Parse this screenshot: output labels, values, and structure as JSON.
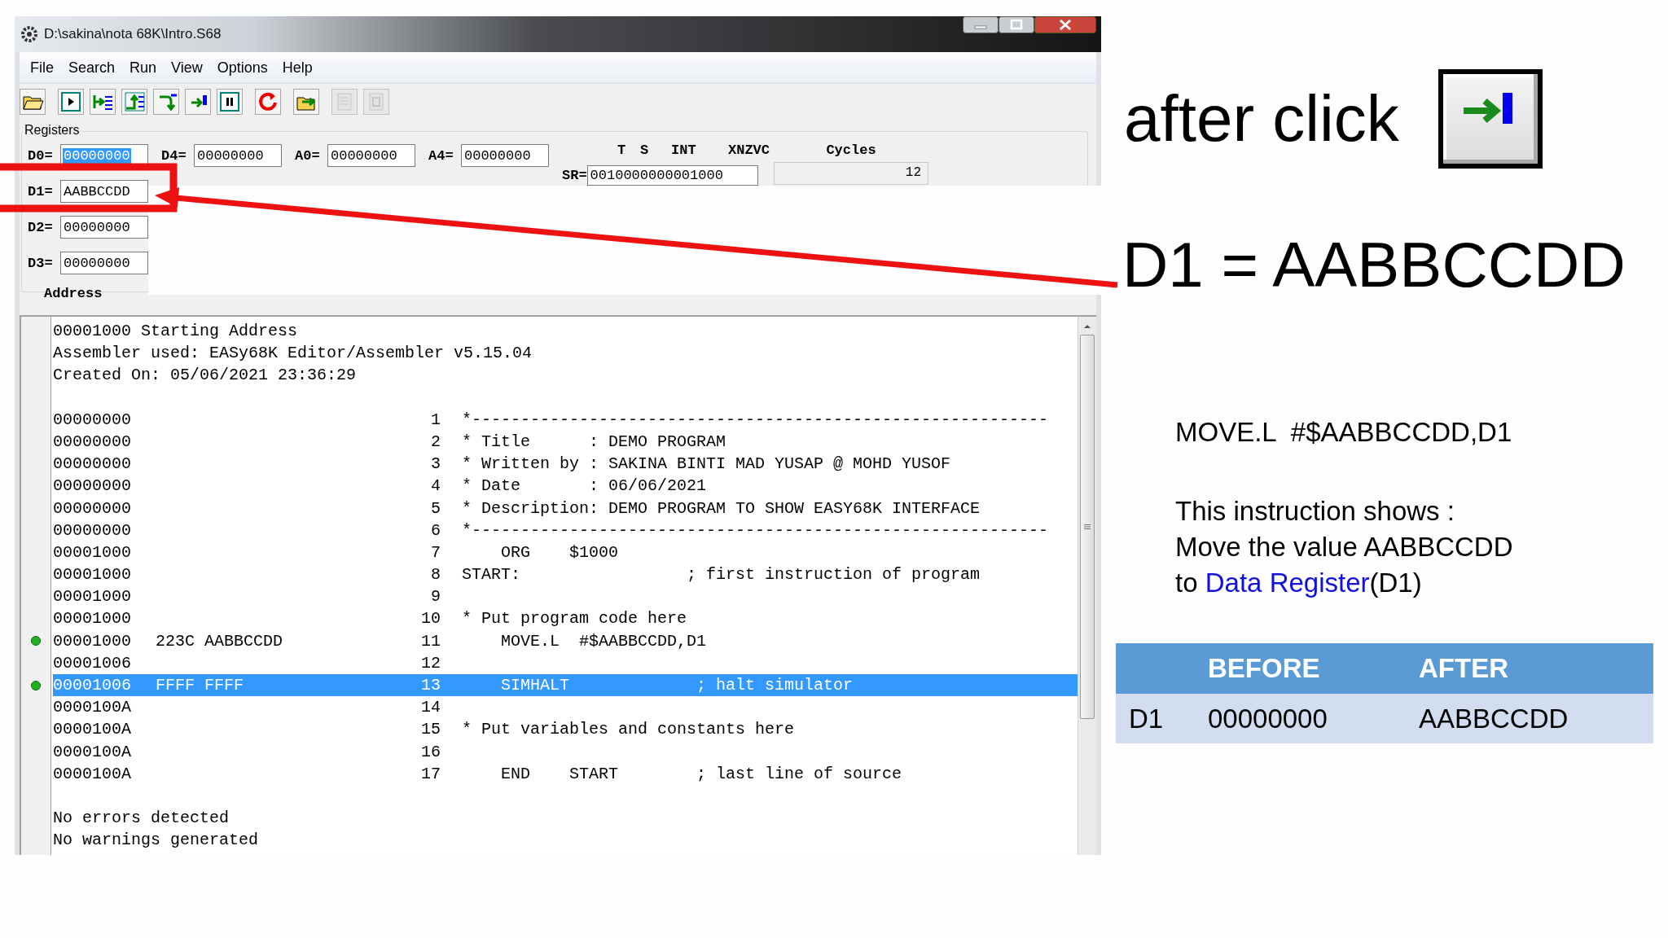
{
  "window": {
    "title": "D:\\sakina\\nota 68K\\Intro.S68"
  },
  "menu": [
    "File",
    "Search",
    "Run",
    "View",
    "Options",
    "Help"
  ],
  "toolbar": [
    {
      "kind": "open",
      "disabled": false
    },
    {
      "kind": "run",
      "disabled": false
    },
    {
      "kind": "run-to-cursor",
      "disabled": false
    },
    {
      "kind": "auto-trace",
      "disabled": false
    },
    {
      "kind": "step-over",
      "disabled": false
    },
    {
      "kind": "trace-into",
      "disabled": false
    },
    {
      "kind": "pause",
      "disabled": false
    },
    {
      "kind": "rewind",
      "disabled": false
    },
    {
      "kind": "reload",
      "disabled": false
    },
    {
      "kind": "log-start",
      "disabled": true
    },
    {
      "kind": "log-stop",
      "disabled": true
    }
  ],
  "registers": {
    "title": "Registers",
    "row": [
      {
        "label": "D0=",
        "value": "00000000",
        "selected": true
      },
      {
        "label": "D4=",
        "value": "00000000",
        "selected": false
      },
      {
        "label": "A0=",
        "value": "00000000",
        "selected": false
      },
      {
        "label": "A4=",
        "value": "00000000",
        "selected": false
      }
    ],
    "column": [
      {
        "label": "D1=",
        "value": "AABBCCDD",
        "selected": false
      },
      {
        "label": "D2=",
        "value": "00000000",
        "selected": false
      },
      {
        "label": "D3=",
        "value": "00000000",
        "selected": false
      }
    ],
    "flags": [
      "T",
      "S",
      "INT",
      "XNZVC"
    ],
    "sr": {
      "label": "SR=",
      "value": "0010000000001000"
    },
    "cycles": {
      "label": "Cycles",
      "value": "12"
    },
    "address_label": "Address"
  },
  "listing": {
    "header": [
      "00001000 Starting Address",
      "Assembler used: EASy68K Editor/Assembler v5.15.04",
      "Created On: 05/06/2021 23:36:29"
    ],
    "rows": [
      {
        "address": "00000000",
        "code": "",
        "line": "1",
        "source": "*-----------------------------------------------------------",
        "marked": false,
        "selected": false
      },
      {
        "address": "00000000",
        "code": "",
        "line": "2",
        "source": "* Title      : DEMO PROGRAM",
        "marked": false,
        "selected": false
      },
      {
        "address": "00000000",
        "code": "",
        "line": "3",
        "source": "* Written by : SAKINA BINTI MAD YUSAP @ MOHD YUSOF",
        "marked": false,
        "selected": false
      },
      {
        "address": "00000000",
        "code": "",
        "line": "4",
        "source": "* Date       : 06/06/2021",
        "marked": false,
        "selected": false
      },
      {
        "address": "00000000",
        "code": "",
        "line": "5",
        "source": "* Description: DEMO PROGRAM TO SHOW EASY68K INTERFACE",
        "marked": false,
        "selected": false
      },
      {
        "address": "00000000",
        "code": "",
        "line": "6",
        "source": "*-----------------------------------------------------------",
        "marked": false,
        "selected": false
      },
      {
        "address": "00001000",
        "code": "",
        "line": "7",
        "source": "    ORG    $1000",
        "marked": false,
        "selected": false
      },
      {
        "address": "00001000",
        "code": "",
        "line": "8",
        "source": "START:                 ; first instruction of program",
        "marked": false,
        "selected": false
      },
      {
        "address": "00001000",
        "code": "",
        "line": "9",
        "source": "",
        "marked": false,
        "selected": false
      },
      {
        "address": "00001000",
        "code": "",
        "line": "10",
        "source": "* Put program code here",
        "marked": false,
        "selected": false
      },
      {
        "address": "00001000",
        "code": "223C AABBCCDD",
        "line": "11",
        "source": "    MOVE.L  #$AABBCCDD,D1",
        "marked": true,
        "selected": false
      },
      {
        "address": "00001006",
        "code": "",
        "line": "12",
        "source": "",
        "marked": false,
        "selected": false
      },
      {
        "address": "00001006",
        "code": "FFFF FFFF",
        "line": "13",
        "source": "    SIMHALT             ; halt simulator",
        "marked": true,
        "selected": true
      },
      {
        "address": "0000100A",
        "code": "",
        "line": "14",
        "source": "",
        "marked": false,
        "selected": false
      },
      {
        "address": "0000100A",
        "code": "",
        "line": "15",
        "source": "* Put variables and constants here",
        "marked": false,
        "selected": false
      },
      {
        "address": "0000100A",
        "code": "",
        "line": "16",
        "source": "",
        "marked": false,
        "selected": false
      },
      {
        "address": "0000100A",
        "code": "",
        "line": "17",
        "source": "    END    START        ; last line of source",
        "marked": false,
        "selected": false
      }
    ],
    "footer": [
      "No errors detected",
      "No warnings generated"
    ]
  },
  "annotation": {
    "caption": "after click",
    "result": "D1 = AABBCCDD",
    "instruction": "MOVE.L  #$AABBCCDD,D1",
    "explanation": {
      "lines": [
        "This instruction shows :",
        "Move the value AABBCCDD"
      ],
      "last": {
        "text": "to",
        "link": "Data Register",
        "after": "(D1)"
      }
    },
    "table": {
      "columns": [
        "BEFORE",
        "AFTER"
      ],
      "rows": [
        {
          "register": "D1",
          "before": "00000000",
          "after": "AABBCCDD"
        }
      ]
    }
  }
}
